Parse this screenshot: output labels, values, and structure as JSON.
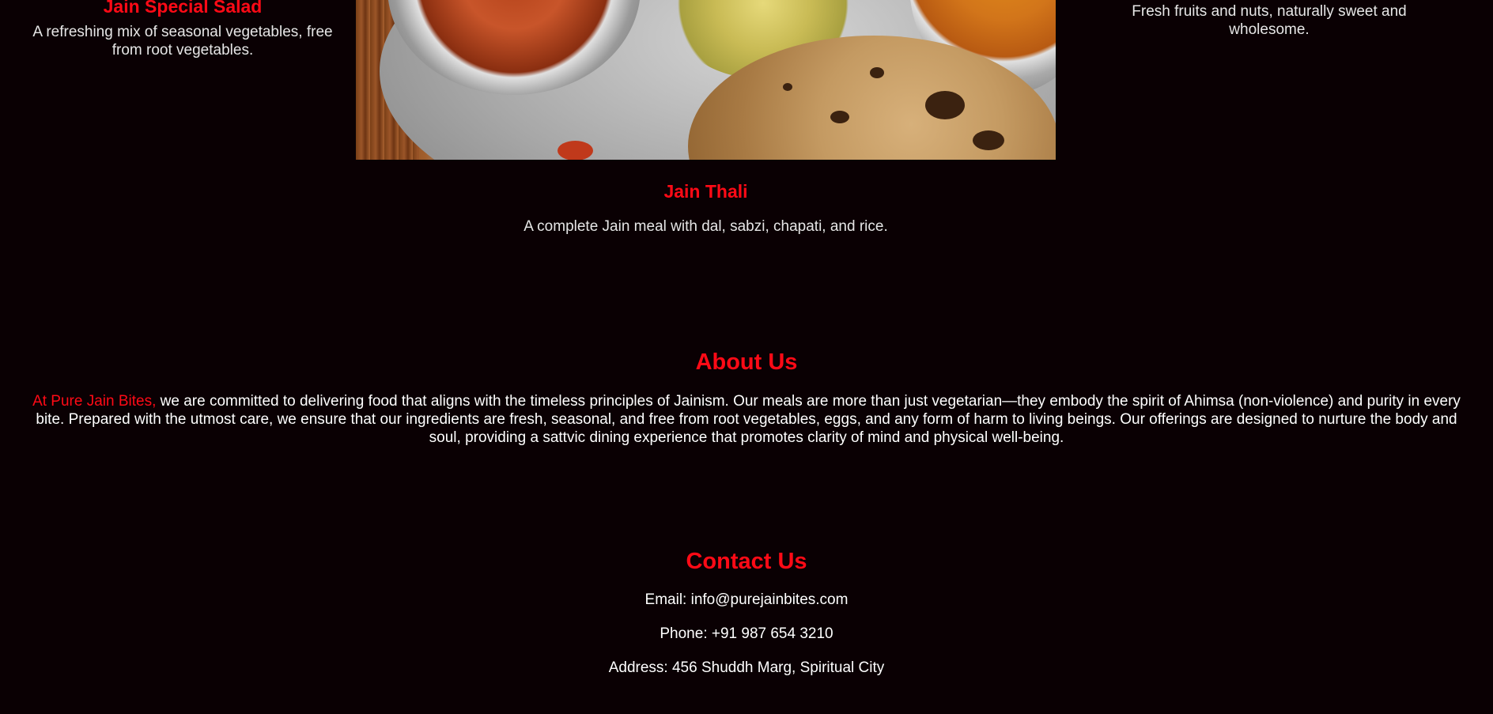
{
  "menu": {
    "items": [
      {
        "title": "Jain Special Salad",
        "description": "A refreshing mix of seasonal vegetables, free from root vegetables."
      },
      {
        "title": "Jain Thali",
        "description": "A complete Jain meal with dal, sabzi, chapati, and rice."
      },
      {
        "title": "",
        "description": "Fresh fruits and nuts, naturally sweet and wholesome."
      }
    ]
  },
  "about": {
    "heading": "About Us",
    "brand_lead": "At Pure Jain Bites,",
    "body": " we are committed to delivering food that aligns with the timeless principles of Jainism. Our meals are more than just vegetarian—they embody the spirit of Ahimsa (non-violence) and purity in every bite. Prepared with the utmost care, we ensure that our ingredients are fresh, seasonal, and free from root vegetables, eggs, and any form of harm to living beings. Our offerings are designed to nurture the body and soul, providing a sattvic dining experience that promotes clarity of mind and physical well-being."
  },
  "contact": {
    "heading": "Contact Us",
    "email": "Email: info@purejainbites.com",
    "phone": "Phone: +91 987 654 3210",
    "address": "Address: 456 Shuddh Marg, Spiritual City"
  },
  "colors": {
    "background": "#0a0003",
    "accent": "#ff0a16",
    "text": "#ffffff"
  }
}
